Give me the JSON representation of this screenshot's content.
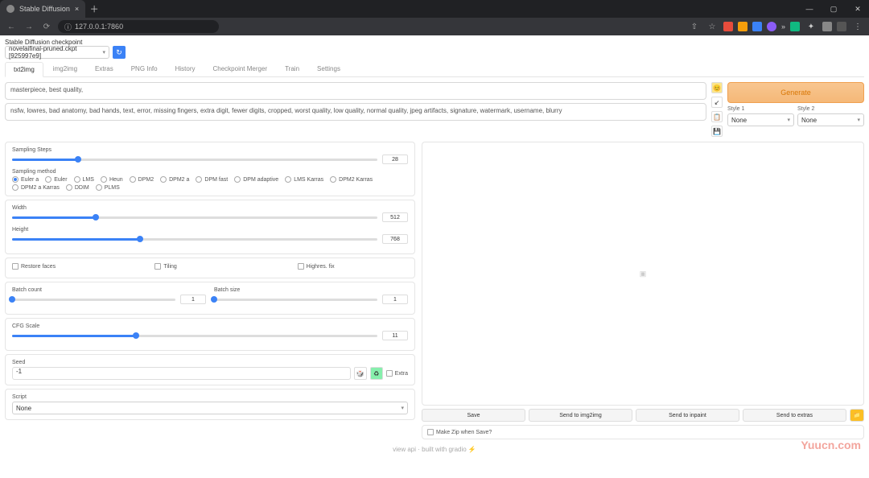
{
  "browser": {
    "tab_title": "Stable Diffusion",
    "url": "127.0.0.1:7860",
    "lock_hint": "ⓘ"
  },
  "checkpoint": {
    "label": "Stable Diffusion checkpoint",
    "value": "novelaifinal-pruned.ckpt [925997e9]"
  },
  "tabs": [
    "txt2img",
    "img2img",
    "Extras",
    "PNG Info",
    "History",
    "Checkpoint Merger",
    "Train",
    "Settings"
  ],
  "active_tab": "txt2img",
  "prompt": "masterpiece, best quality,",
  "neg_prompt": "nsfw, lowres, bad anatomy, bad hands, text, error, missing fingers, extra digit, fewer digits, cropped, worst quality, low quality, normal quality, jpeg artifacts, signature, watermark, username, blurry",
  "generate_label": "Generate",
  "style1": {
    "label": "Style 1",
    "value": "None"
  },
  "style2": {
    "label": "Style 2",
    "value": "None"
  },
  "sampling_steps": {
    "label": "Sampling Steps",
    "value": "28",
    "pct": 28
  },
  "sampling_method": {
    "label": "Sampling method",
    "options": [
      "Euler a",
      "Euler",
      "LMS",
      "Heun",
      "DPM2",
      "DPM2 a",
      "DPM fast",
      "DPM adaptive",
      "LMS Karras",
      "DPM2 Karras",
      "DPM2 a Karras",
      "DDIM",
      "PLMS"
    ],
    "selected": "Euler a"
  },
  "width": {
    "label": "Width",
    "value": "512",
    "pct": 23
  },
  "height": {
    "label": "Height",
    "value": "768",
    "pct": 35
  },
  "restore_faces": "Restore faces",
  "tiling": "Tiling",
  "highres": "Highres. fix",
  "batch_count": {
    "label": "Batch count",
    "value": "1",
    "pct": 0
  },
  "batch_size": {
    "label": "Batch size",
    "value": "1",
    "pct": 0
  },
  "cfg": {
    "label": "CFG Scale",
    "value": "11",
    "pct": 34
  },
  "seed": {
    "label": "Seed",
    "value": "-1",
    "extra_label": "Extra"
  },
  "script": {
    "label": "Script",
    "value": "None"
  },
  "output": {
    "save": "Save",
    "send_img2img": "Send to img2img",
    "send_inpaint": "Send to inpaint",
    "send_extras": "Send to extras",
    "zip": "Make Zip when Save?"
  },
  "footer": "view api  ·  built with gradio ⚡",
  "watermark": "Yuucn.com"
}
